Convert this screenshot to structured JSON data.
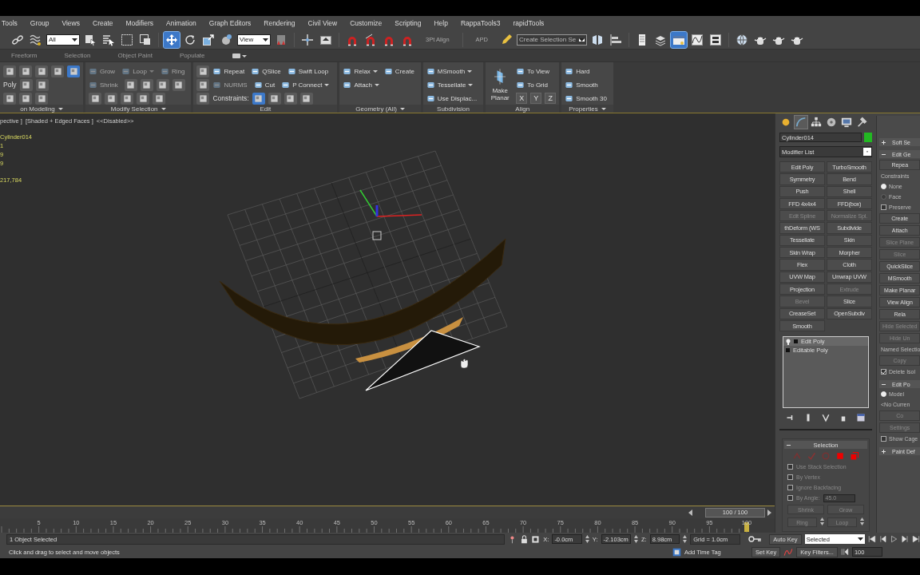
{
  "menu_bar": [
    "Tools",
    "Group",
    "Views",
    "Create",
    "Modifiers",
    "Animation",
    "Graph Editors",
    "Rendering",
    "Civil View",
    "Customize",
    "Scripting",
    "Help",
    "RappaTools3",
    "rapidTools"
  ],
  "main_toolbar": [
    {
      "kind": "link",
      "selected": false
    },
    {
      "kind": "bind",
      "selected": false
    },
    {
      "kind": "dropdown",
      "value": "All"
    },
    {
      "kind": "select",
      "selected": false
    },
    {
      "kind": "selname",
      "selected": false
    },
    {
      "kind": "rect",
      "selected": false
    },
    {
      "kind": "window",
      "selected": false
    },
    {
      "kind": "sep"
    },
    {
      "kind": "move",
      "selected": true
    },
    {
      "kind": "rotate",
      "selected": false
    },
    {
      "kind": "scale",
      "selected": false
    },
    {
      "kind": "place",
      "selected": false
    },
    {
      "kind": "dropdown",
      "value": "View"
    },
    {
      "kind": "pivot",
      "selected": false
    },
    {
      "kind": "sep"
    },
    {
      "kind": "manip",
      "selected": false
    },
    {
      "kind": "keyb",
      "selected": false
    },
    {
      "kind": "sep"
    },
    {
      "kind": "magnet",
      "selected": false
    },
    {
      "kind": "angle",
      "selected": false
    },
    {
      "kind": "magnet",
      "selected": false
    },
    {
      "kind": "magnet",
      "selected": false
    },
    {
      "kind": "label",
      "value": "3Pt Align"
    },
    {
      "kind": "sep"
    },
    {
      "kind": "label",
      "value": "APD"
    },
    {
      "kind": "pencil",
      "selected": false
    },
    {
      "kind": "dropdown",
      "value": "Create Selection Se"
    },
    {
      "kind": "mirror",
      "selected": false
    },
    {
      "kind": "align",
      "selected": false
    },
    {
      "kind": "sep"
    },
    {
      "kind": "layers",
      "selected": false
    },
    {
      "kind": "explorer",
      "selected": false
    },
    {
      "kind": "panel",
      "selected": true
    },
    {
      "kind": "curve",
      "selected": false
    },
    {
      "kind": "schematic",
      "selected": false
    },
    {
      "kind": "sep"
    },
    {
      "kind": "globe",
      "selected": false
    },
    {
      "kind": "teapot",
      "selected": false
    },
    {
      "kind": "teapot",
      "selected": false
    },
    {
      "kind": "teapot",
      "selected": false
    }
  ],
  "ribbon": {
    "tabs": [
      "Freeform",
      "Selection",
      "Object Paint",
      "Populate"
    ],
    "panels": [
      {
        "title": "on Modeling",
        "menu": true,
        "rows": [
          [
            {
              "kind": "icon",
              "selected": false
            },
            {
              "kind": "icon",
              "selected": false
            },
            {
              "kind": "icon",
              "selected": false
            },
            {
              "kind": "icon",
              "selected": false
            },
            {
              "kind": "icon",
              "selected": true
            }
          ],
          [
            {
              "kind": "label",
              "label": "Poly"
            },
            {
              "kind": "icon",
              "selected": false
            },
            {
              "kind": "icon",
              "selected": false
            }
          ],
          [
            {
              "kind": "icon",
              "selected": false
            },
            {
              "kind": "icon",
              "selected": false
            },
            {
              "kind": "icon",
              "selected": false
            }
          ]
        ]
      },
      {
        "title": "Modify Selection",
        "menu": true,
        "rows": [
          [
            {
              "kind": "tool",
              "label": "Grow",
              "menu": false,
              "disabled": true
            },
            {
              "kind": "tool",
              "label": "Loop",
              "menu": true,
              "disabled": true
            },
            {
              "kind": "tool",
              "label": "Ring",
              "menu": false,
              "disabled": true
            }
          ],
          [
            {
              "kind": "tool",
              "label": "Shrink",
              "menu": false,
              "disabled": true
            },
            {
              "kind": "icon",
              "selected": false
            },
            {
              "kind": "icon",
              "selected": false
            },
            {
              "kind": "icon",
              "selected": false
            },
            {
              "kind": "icon",
              "selected": false
            }
          ],
          [
            {
              "kind": "icon",
              "selected": false
            },
            {
              "kind": "icon",
              "selected": false
            },
            {
              "kind": "icon",
              "selected": false
            },
            {
              "kind": "icon",
              "selected": false
            },
            {
              "kind": "icon",
              "selected": false
            }
          ]
        ]
      },
      {
        "title": "Edit",
        "menu": false,
        "rows": [
          [
            {
              "kind": "icon",
              "selected": false
            },
            {
              "kind": "tool",
              "label": "Repeat",
              "menu": false,
              "disabled": false
            },
            {
              "kind": "tool",
              "label": "QSlice",
              "menu": false,
              "disabled": false
            },
            {
              "kind": "tool",
              "label": "Swift Loop",
              "menu": false,
              "disabled": false
            }
          ],
          [
            {
              "kind": "icon",
              "selected": false
            },
            {
              "kind": "tool",
              "label": "NURMS",
              "menu": false,
              "disabled": true
            },
            {
              "kind": "tool",
              "label": "Cut",
              "menu": false,
              "disabled": false
            },
            {
              "kind": "tool",
              "label": "P Connect",
              "menu": true,
              "disabled": false
            }
          ],
          [
            {
              "kind": "icon",
              "selected": false
            },
            {
              "kind": "label",
              "label": "Constraints:"
            },
            {
              "kind": "icon",
              "selected": true
            },
            {
              "kind": "icon",
              "selected": false
            },
            {
              "kind": "icon",
              "selected": false
            },
            {
              "kind": "icon",
              "selected": false
            }
          ]
        ]
      },
      {
        "title": "Geometry (All)",
        "menu": true,
        "rows": [
          [
            {
              "kind": "tool",
              "label": "Relax",
              "menu": true,
              "disabled": false
            },
            {
              "kind": "tool",
              "label": "Create",
              "menu": false,
              "disabled": false
            }
          ],
          [
            {
              "kind": "tool",
              "label": "Attach",
              "menu": true,
              "disabled": false
            }
          ],
          []
        ]
      },
      {
        "title": "Subdivision",
        "menu": false,
        "rows": [
          [
            {
              "kind": "tool",
              "label": "MSmooth",
              "menu": true,
              "disabled": false
            }
          ],
          [
            {
              "kind": "tool",
              "label": "Tessellate",
              "menu": true,
              "disabled": false
            }
          ],
          [
            {
              "kind": "tool",
              "label": "Use Displac...",
              "menu": false,
              "disabled": false
            }
          ]
        ]
      },
      {
        "title": "Align",
        "menu": false,
        "large": "Make Planar",
        "rows": [
          [
            {
              "kind": "tool",
              "label": "To View",
              "menu": false,
              "disabled": false
            }
          ],
          [
            {
              "kind": "tool",
              "label": "To Grid",
              "menu": false,
              "disabled": false
            }
          ],
          [
            {
              "kind": "axis",
              "label": "X"
            },
            {
              "kind": "axis",
              "label": "Y"
            },
            {
              "kind": "axis",
              "label": "Z"
            }
          ]
        ]
      },
      {
        "title": "Properties",
        "menu": true,
        "rows": [
          [
            {
              "kind": "tool",
              "label": "Hard",
              "menu": false,
              "disabled": false
            }
          ],
          [
            {
              "kind": "tool",
              "label": "Smooth",
              "menu": false,
              "disabled": false
            }
          ],
          [
            {
              "kind": "tool",
              "label": "Smooth 30",
              "menu": false,
              "disabled": false
            }
          ]
        ]
      }
    ]
  },
  "viewport": {
    "labels": [
      "pective ]",
      "[Shaded + Edged Faces ]",
      "<<Disabled>>"
    ],
    "stats": [
      "Cylinder014",
      "1",
      "9",
      "9",
      "217,784"
    ]
  },
  "time_slider": {
    "reading": "100 / 100",
    "level": 1
  },
  "track_bar": {
    "ticks": [
      "5",
      "10",
      "15",
      "20",
      "25",
      "30",
      "35",
      "40",
      "45",
      "50",
      "55",
      "60",
      "65",
      "70",
      "75",
      "80",
      "85",
      "90",
      "95",
      "100"
    ]
  },
  "command_panel": {
    "tabs": [
      {
        "selected": false
      },
      {
        "selected": true
      },
      {
        "selected": false
      },
      {
        "selected": false
      },
      {
        "selected": false
      },
      {
        "selected": false
      }
    ],
    "object_name": "Cylinder014",
    "modifier_list": "Modifier List",
    "modifiers": [
      {
        "label": "Edit Poly",
        "disabled": false
      },
      {
        "label": "TurboSmooth",
        "disabled": false
      },
      {
        "label": "Symmetry",
        "disabled": false
      },
      {
        "label": "Bend",
        "disabled": false
      },
      {
        "label": "Push",
        "disabled": false
      },
      {
        "label": "Shell",
        "disabled": false
      },
      {
        "label": "FFD 4x4x4",
        "disabled": false
      },
      {
        "label": "FFD(box)",
        "disabled": false
      },
      {
        "label": "Edit Spline",
        "disabled": true
      },
      {
        "label": "Normalize Spl.",
        "disabled": true
      },
      {
        "label": "thDeform (WS",
        "disabled": false
      },
      {
        "label": "Subdivide",
        "disabled": false
      },
      {
        "label": "Tessellate",
        "disabled": false
      },
      {
        "label": "Skin",
        "disabled": false
      },
      {
        "label": "Skin Wrap",
        "disabled": false
      },
      {
        "label": "Morpher",
        "disabled": false
      },
      {
        "label": "Flex",
        "disabled": false
      },
      {
        "label": "Cloth",
        "disabled": false
      },
      {
        "label": "UVW Map",
        "disabled": false
      },
      {
        "label": "Unwrap UVW",
        "disabled": false
      },
      {
        "label": "Projection",
        "disabled": false
      },
      {
        "label": "Extrude",
        "disabled": true
      },
      {
        "label": "Bevel",
        "disabled": true
      },
      {
        "label": "Slice",
        "disabled": false
      },
      {
        "label": "CreaseSet",
        "disabled": false
      },
      {
        "label": "OpenSubdiv",
        "disabled": false
      },
      {
        "label": "Smooth",
        "disabled": false
      }
    ],
    "stack": [
      {
        "label": "Edit Poly",
        "selected": true
      },
      {
        "label": "Editable Poly",
        "selected": false
      }
    ],
    "selection": {
      "title": "Selection",
      "expanded": true,
      "options": [
        {
          "label": "Use Stack Selection",
          "checked": false
        },
        {
          "label": "By Vertex",
          "checked": false
        },
        {
          "label": "Ignore Backfacing",
          "checked": false
        },
        {
          "label": "By Angle:",
          "checked": false
        }
      ],
      "angle": "45.0",
      "buttons": [
        "Shrink",
        "Grow"
      ],
      "spinner_buttons": [
        "Ring",
        "Loop"
      ]
    },
    "side_rollouts": [
      {
        "kind": "header",
        "label": "Soft Se",
        "expanded": false
      },
      {
        "kind": "header",
        "label": "Edit Ge",
        "expanded": true
      },
      {
        "kind": "button",
        "label": "Repea",
        "disabled": false
      },
      {
        "kind": "group",
        "label": "Constraints"
      },
      {
        "kind": "radio",
        "label": "None",
        "selected": true
      },
      {
        "kind": "radio",
        "label": "Face",
        "selected": false
      },
      {
        "kind": "checkbox",
        "label": "Preserve",
        "checked": false
      },
      {
        "kind": "button",
        "label": "Create",
        "disabled": false
      },
      {
        "kind": "button",
        "label": "Attach",
        "disabled": false
      },
      {
        "kind": "button",
        "label": "Slice Plane",
        "disabled": true
      },
      {
        "kind": "button",
        "label": "Slice",
        "disabled": true
      },
      {
        "kind": "button",
        "label": "QuickSlice",
        "disabled": false
      },
      {
        "kind": "button",
        "label": "MSmooth",
        "disabled": false
      },
      {
        "kind": "button",
        "label": "Make Planar",
        "disabled": false
      },
      {
        "kind": "button",
        "label": "View Align",
        "disabled": false
      },
      {
        "kind": "button",
        "label": "Rela",
        "disabled": false
      },
      {
        "kind": "button",
        "label": "Hide Selected",
        "disabled": true
      },
      {
        "kind": "button",
        "label": "Hide Un",
        "disabled": true
      },
      {
        "kind": "group",
        "label": "Named Selectio"
      },
      {
        "kind": "button",
        "label": "Copy",
        "disabled": true
      },
      {
        "kind": "checkbox",
        "label": "Delete Isol",
        "checked": true
      },
      {
        "kind": "header",
        "label": "Edit Po",
        "expanded": true
      },
      {
        "kind": "radio",
        "label": "Model",
        "selected": true
      },
      {
        "kind": "group",
        "label": "<No Curren"
      },
      {
        "kind": "button",
        "label": "Co",
        "disabled": true
      },
      {
        "kind": "button",
        "label": "Settings",
        "disabled": true
      },
      {
        "kind": "checkbox",
        "label": "Show Cage",
        "checked": false
      },
      {
        "kind": "header",
        "label": "Paint Def",
        "expanded": false
      }
    ]
  },
  "status_bar": {
    "selection": "1 Object Selected",
    "prompt": "Click and drag to select and move objects",
    "coordinates": [
      {
        "label": "X:",
        "value": "-0.0cm"
      },
      {
        "label": "Y:",
        "value": "-2.103cm"
      },
      {
        "label": "Z:",
        "value": "8.98cm"
      }
    ],
    "grid": "Grid = 1.0cm",
    "time_tag": "Add Time Tag",
    "auto_key": "Auto Key",
    "key_mode": "Selected",
    "set_key": "Set Key",
    "key_filters": "Key Filters...",
    "frame": "100"
  }
}
